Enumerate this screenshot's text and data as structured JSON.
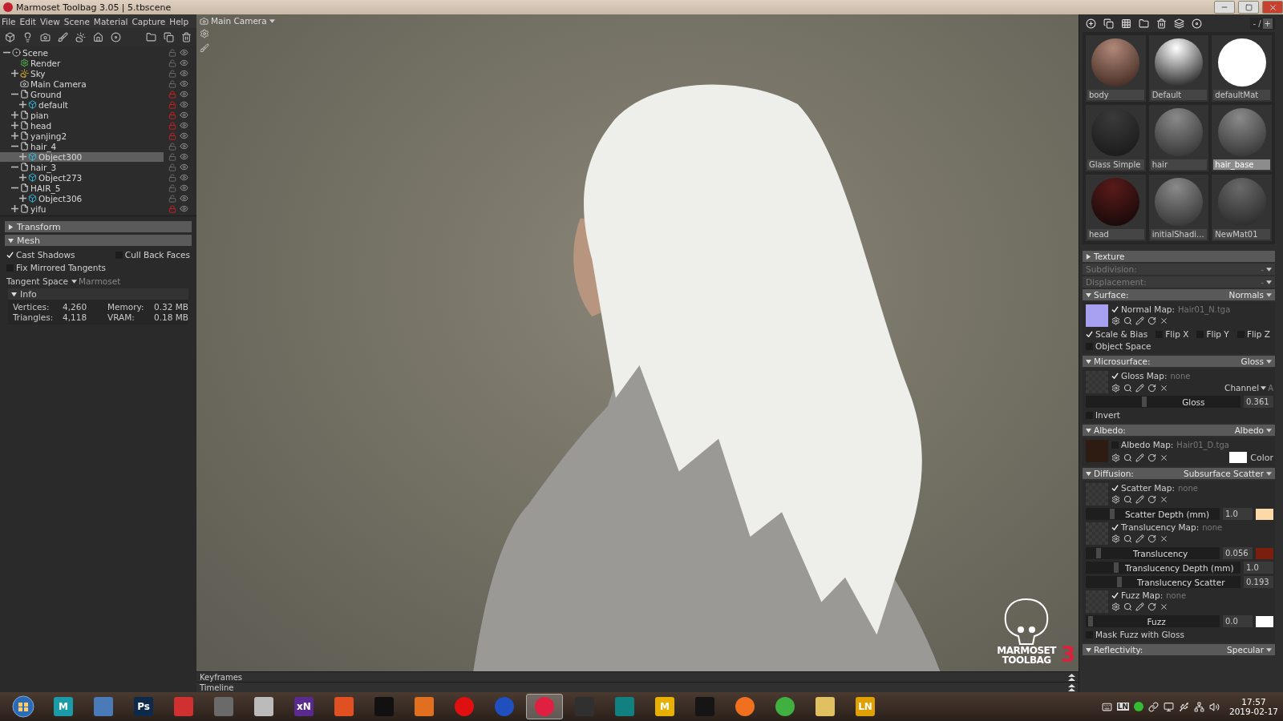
{
  "window": {
    "title": "Marmoset Toolbag 3.05  |  5.tbscene"
  },
  "menu": [
    "File",
    "Edit",
    "View",
    "Scene",
    "Material",
    "Capture",
    "Help"
  ],
  "scene_tree": [
    {
      "label": "Scene",
      "kind": "scene",
      "expanded": true,
      "locked": false,
      "selected": false,
      "children": [
        {
          "label": "Render",
          "kind": "render",
          "locked": false,
          "selected": false
        },
        {
          "label": "Sky",
          "kind": "sky",
          "expanded": false,
          "locked": false,
          "selected": false
        },
        {
          "label": "Main Camera",
          "kind": "camera",
          "locked": false,
          "selected": false
        },
        {
          "label": "Ground",
          "kind": "group",
          "expanded": true,
          "locked": true,
          "selected": false,
          "children": [
            {
              "label": "default",
              "kind": "mesh",
              "expanded": false,
              "locked": true,
              "selected": false
            }
          ]
        },
        {
          "label": "pian",
          "kind": "group",
          "expanded": false,
          "locked": true,
          "selected": false
        },
        {
          "label": "head",
          "kind": "group",
          "expanded": false,
          "locked": true,
          "selected": false
        },
        {
          "label": "yanjing2",
          "kind": "group",
          "expanded": false,
          "locked": true,
          "selected": false
        },
        {
          "label": "hair_4",
          "kind": "group",
          "expanded": true,
          "locked": false,
          "selected": false,
          "children": [
            {
              "label": "Object300",
              "kind": "mesh",
              "expanded": false,
              "locked": false,
              "selected": true
            }
          ]
        },
        {
          "label": "hair_3",
          "kind": "group",
          "expanded": true,
          "locked": false,
          "selected": false,
          "children": [
            {
              "label": "Object273",
              "kind": "mesh",
              "expanded": false,
              "locked": false,
              "selected": false
            }
          ]
        },
        {
          "label": "HAIR_5",
          "kind": "group",
          "expanded": true,
          "locked": false,
          "selected": false,
          "children": [
            {
              "label": "Object306",
              "kind": "mesh",
              "expanded": false,
              "locked": false,
              "selected": false
            }
          ]
        },
        {
          "label": "yifu",
          "kind": "group",
          "expanded": false,
          "locked": true,
          "selected": false
        }
      ]
    }
  ],
  "properties": [
    {
      "title": "Transform",
      "expanded": false
    },
    {
      "title": "Mesh",
      "expanded": true,
      "checks": [
        {
          "label": "Cast Shadows",
          "checked": true
        },
        {
          "label": "Cull Back Faces",
          "checked": false
        },
        {
          "label": "Fix Mirrored Tangents",
          "checked": false
        }
      ],
      "dropdown": {
        "label": "Tangent Space",
        "value": "Marmoset"
      },
      "info": {
        "title": "Info",
        "expanded": true,
        "stats": [
          {
            "label": "Vertices:",
            "value": "4,260"
          },
          {
            "label": "Memory:",
            "value": "0.32 MB"
          },
          {
            "label": "Triangles:",
            "value": "4,118"
          },
          {
            "label": "VRAM:",
            "value": "0.18 MB"
          }
        ]
      }
    }
  ],
  "viewport": {
    "camera": "Main Camera",
    "logo": {
      "line1": "MARMOSET",
      "line2": "TOOLBAG",
      "version": "3"
    }
  },
  "timeline": [
    "Keyframes",
    "Timeline"
  ],
  "materials": {
    "counter": "- /",
    "counter_button": "+",
    "grid": [
      {
        "name": "body",
        "kind": "skin",
        "selected": false
      },
      {
        "name": "Default",
        "kind": "chrome",
        "selected": false
      },
      {
        "name": "defaultMat",
        "kind": "white",
        "selected": false
      },
      {
        "name": "Glass Simple",
        "kind": "glass",
        "selected": false
      },
      {
        "name": "hair",
        "kind": "matte",
        "selected": false
      },
      {
        "name": "hair_base",
        "kind": "matte",
        "selected": true
      },
      {
        "name": "head",
        "kind": "head",
        "selected": false
      },
      {
        "name": "initialShadi...",
        "kind": "matte",
        "selected": false
      },
      {
        "name": "NewMat01",
        "kind": "dark",
        "selected": false
      }
    ]
  },
  "texture": {
    "title": "Texture",
    "expanded": false
  },
  "texture_rows": [
    {
      "label": "Subdivision:",
      "value": "-",
      "disabled": true
    },
    {
      "label": "Displacement:",
      "value": "-",
      "disabled": true
    }
  ],
  "sections": [
    {
      "title": "Surface:",
      "value": "Normals",
      "expanded": true,
      "rows": [
        {
          "kind": "map",
          "label": "Normal Map:",
          "file": "Hair01_N.tga",
          "checked": true,
          "thumbnail": {
            "color": "#a8a0f0"
          }
        },
        {
          "kind": "checks",
          "items": [
            {
              "label": "Scale & Bias",
              "checked": true
            },
            {
              "label": "Flip X",
              "checked": false
            },
            {
              "label": "Flip Y",
              "checked": false
            },
            {
              "label": "Flip Z",
              "checked": false
            }
          ]
        },
        {
          "kind": "checks",
          "items": [
            {
              "label": "Object Space",
              "checked": false
            }
          ]
        }
      ]
    },
    {
      "title": "Microsurface:",
      "value": "Gloss",
      "expanded": true,
      "rows": [
        {
          "kind": "map",
          "label": "Gloss Map:",
          "file": "none",
          "checked": true,
          "channel": {
            "label": "Channel",
            "value": "A"
          }
        },
        {
          "kind": "slider",
          "label": "Gloss",
          "value": "0.361",
          "level": 0.361
        },
        {
          "kind": "checks",
          "items": [
            {
              "label": "Invert",
              "checked": false
            }
          ]
        }
      ]
    },
    {
      "title": "Albedo:",
      "value": "Albedo",
      "expanded": true,
      "rows": [
        {
          "kind": "map",
          "label": "Albedo Map:",
          "file": "Hair01_D.tga",
          "checked": false,
          "thumbnail": {
            "color": "#2e1c12"
          },
          "color": "#ffffff",
          "color_label": "Color"
        }
      ]
    },
    {
      "title": "Diffusion:",
      "value": "Subsurface Scatter",
      "expanded": true,
      "rows": [
        {
          "kind": "map",
          "label": "Scatter Map:",
          "file": "none",
          "checked": true
        },
        {
          "kind": "slider",
          "label": "Scatter Depth (mm)",
          "value": "1.0",
          "level": 0.18,
          "color": "#fcd9a8"
        },
        {
          "kind": "map",
          "label": "Translucency Map:",
          "file": "none",
          "checked": true
        },
        {
          "kind": "slider",
          "label": "Translucency",
          "value": "0.056",
          "level": 0.08,
          "color": "#7a1e0e"
        },
        {
          "kind": "slider",
          "label": "Translucency Depth (mm)",
          "value": "1.0",
          "level": 0.18
        },
        {
          "kind": "slider",
          "label": "Translucency Scatter",
          "value": "0.193",
          "level": 0.2
        },
        {
          "kind": "map",
          "label": "Fuzz Map:",
          "file": "none",
          "checked": true
        },
        {
          "kind": "slider",
          "label": "Fuzz",
          "value": "0.0",
          "level": 0.02,
          "color": "#ffffff"
        },
        {
          "kind": "checks",
          "items": [
            {
              "label": "Mask Fuzz with Gloss",
              "checked": false
            }
          ]
        }
      ]
    },
    {
      "title": "Reflectivity:",
      "value": "Specular",
      "expanded": true
    }
  ],
  "taskbar": [
    {
      "kind": "start",
      "selected": false
    },
    {
      "kind": "letter",
      "label": "M",
      "color": "#1b9aa8",
      "selected": false
    },
    {
      "kind": "tile",
      "color": "#4a7ab8",
      "selected": false
    },
    {
      "kind": "letter",
      "label": "Ps",
      "color": "#0d2a4a",
      "selected": false
    },
    {
      "kind": "tile",
      "color": "#d03030",
      "selected": false
    },
    {
      "kind": "tile",
      "color": "#6a6a6a",
      "selected": false
    },
    {
      "kind": "tile",
      "color": "#bbbbbb",
      "selected": false
    },
    {
      "kind": "letter",
      "label": "xN",
      "color": "#5a2a90",
      "selected": false
    },
    {
      "kind": "tile",
      "color": "#e05020",
      "selected": false
    },
    {
      "kind": "tile",
      "color": "#111111",
      "selected": false
    },
    {
      "kind": "tile",
      "color": "#e07020",
      "selected": false
    },
    {
      "kind": "disc",
      "color": "#e01010",
      "selected": false
    },
    {
      "kind": "disc",
      "color": "#2050c0",
      "selected": false
    },
    {
      "kind": "disc",
      "color": "#e02040",
      "selected": true
    },
    {
      "kind": "tile",
      "color": "#303030",
      "selected": false
    },
    {
      "kind": "tile",
      "color": "#108080",
      "selected": false
    },
    {
      "kind": "letter",
      "label": "M",
      "color": "#e8b000",
      "selected": false
    },
    {
      "kind": "tile",
      "color": "#151515",
      "selected": false
    },
    {
      "kind": "disc",
      "color": "#f07020",
      "selected": false
    },
    {
      "kind": "disc",
      "color": "#40b040",
      "selected": false
    },
    {
      "kind": "tile",
      "color": "#e0c060",
      "selected": false
    },
    {
      "kind": "letter",
      "label": "LN",
      "color": "#e0a000",
      "selected": false
    }
  ],
  "tray": {
    "icons": [
      {
        "kind": "keyboard"
      },
      {
        "kind": "letter",
        "label": "LN"
      },
      {
        "kind": "disc"
      },
      {
        "kind": "link"
      },
      {
        "kind": "monitor"
      },
      {
        "kind": "usb"
      },
      {
        "kind": "network"
      },
      {
        "kind": "volume"
      }
    ],
    "time": "17:57",
    "date": "2019-02-17"
  }
}
